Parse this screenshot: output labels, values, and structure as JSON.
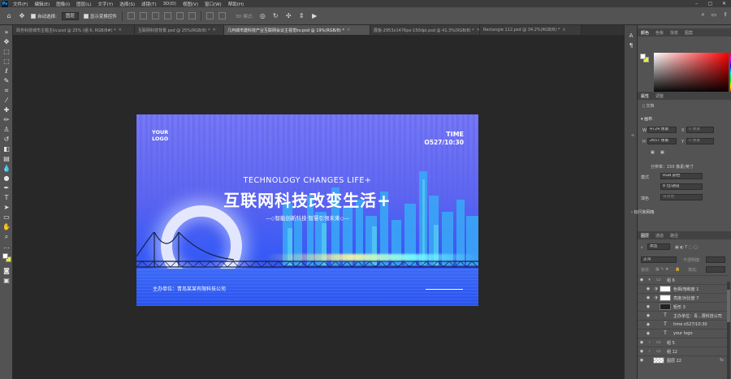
{
  "app": {
    "icon": "Ps"
  },
  "menu": [
    "文件(F)",
    "编辑(E)",
    "图像(I)",
    "图层(L)",
    "文字(Y)",
    "选择(S)",
    "滤镜(T)",
    "3D(D)",
    "视图(V)",
    "窗口(W)",
    "帮助(H)"
  ],
  "options": {
    "auto_select_label": "自动选择:",
    "auto_select_value": "图层",
    "show_transform_label": "显示变换控件",
    "mode3d_label": "3D 模式:"
  },
  "tabs": [
    {
      "label": "政务科技城市主题主kv.psd @ 25% (组 6, RGB/8#) *",
      "active": false
    },
    {
      "label": "互联网科技背景.psd @ 25%(RGB/8) *",
      "active": false
    },
    {
      "label": "几何城市建科技产业互联网会议主视觉kv.psd @ 19%(RGB/8) *",
      "active": true
    },
    {
      "label": "展板-2953x1476px-150dpi.psd @ 41.3%(RGB/8) *",
      "active": false
    },
    {
      "label": "Rectangle 112.psd @ 34.2%(RGB/8) *",
      "active": false
    }
  ],
  "canvas": {
    "logo": "YOUR\nLOGO",
    "time_label": "TIME",
    "time_value": "O527/10:30",
    "tagline": "TECHNOLOGY CHANGES LIFE+",
    "headline": "互联网科技改变生活+",
    "subline": "—◇智能创新科技·智慧引领未来◇—",
    "sponsor": "主办单位：青岛某某有限科技公司"
  },
  "panels": {
    "color_tabs": [
      "颜色",
      "色板",
      "渐变",
      "图案"
    ],
    "props_tabs": [
      "属性",
      "调整"
    ],
    "doc_label": "文档",
    "canvas_section": "画布",
    "width_label": "W",
    "width_value": "4724 像素",
    "height_label": "H",
    "height_value": "2657 像素",
    "x_label": "X",
    "x_placeholder": "0 像素",
    "y_label": "Y",
    "y_placeholder": "0 像素",
    "resolution": "分辨率：150 像素/英寸",
    "mode_label": "模式",
    "mode_value": "RGB 颜色",
    "depth_value": "8 位/通道",
    "fill_label": "填色",
    "fill_value": "背景色",
    "rulers_section": "标尺和网格",
    "layer_tabs": [
      "图层",
      "通道",
      "路径"
    ],
    "layer_kind": "类型",
    "blend_mode": "正常",
    "opacity_label": "不透明度:",
    "lock_label": "锁定:",
    "fill2_label": "填充:",
    "layers": [
      {
        "name": "组 6",
        "kind": "folder",
        "twirl": "▾"
      },
      {
        "name": "色相/饱和度 1",
        "kind": "adj",
        "twirl": ""
      },
      {
        "name": "亮度/对比度 7",
        "kind": "adj",
        "twirl": ""
      },
      {
        "name": "矩形 3",
        "kind": "shape",
        "twirl": ""
      },
      {
        "name": "主办单位：青...限科技公司",
        "kind": "text",
        "twirl": ""
      },
      {
        "name": "time o527/10:30",
        "kind": "text",
        "twirl": ""
      },
      {
        "name": "your logo",
        "kind": "text",
        "twirl": ""
      },
      {
        "name": "组 5",
        "kind": "folder",
        "twirl": "›"
      },
      {
        "name": "组 12",
        "kind": "folder",
        "twirl": "›"
      },
      {
        "name": "图层 22",
        "kind": "pixel",
        "twirl": ""
      }
    ]
  },
  "colors": {
    "foreground": "#ffffff",
    "background": "#e8ef3c",
    "accent": "#31a8ff"
  }
}
